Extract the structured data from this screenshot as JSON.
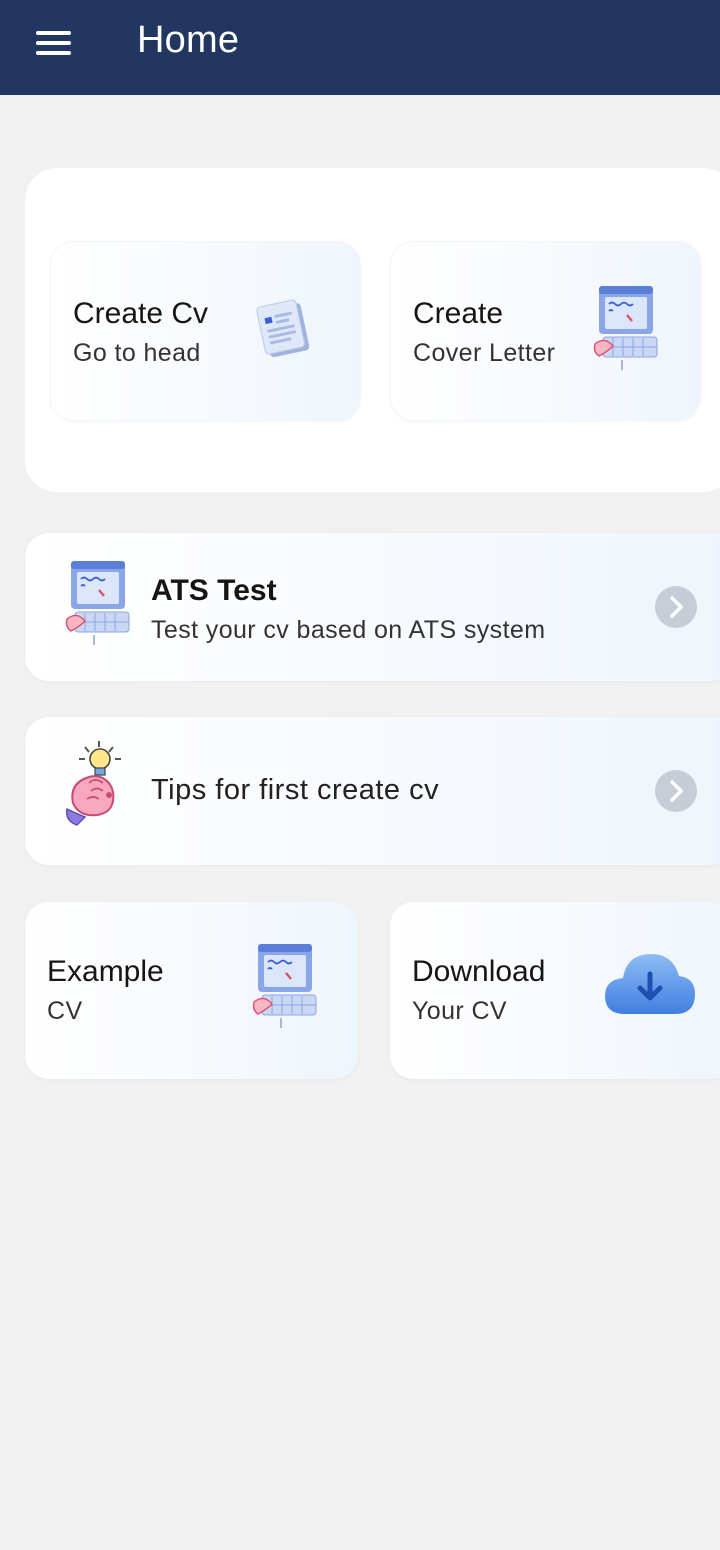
{
  "header": {
    "title": "Home",
    "menu_icon": "hamburger-menu-icon"
  },
  "top_cards": [
    {
      "title": "Create Cv",
      "subtitle": "Go to head",
      "icon": "document-icon"
    },
    {
      "title": "Create",
      "subtitle": "Cover Letter",
      "icon": "computer-icon"
    }
  ],
  "list_items": [
    {
      "title": "ATS Test",
      "subtitle": "Test your cv based on ATS system",
      "icon": "computer-icon",
      "action_icon": "chevron-right-icon"
    },
    {
      "title": "Tips for first create cv",
      "icon": "lightbulb-hand-icon",
      "action_icon": "chevron-right-icon"
    }
  ],
  "bottom_cards": [
    {
      "title": "Example",
      "subtitle": "CV",
      "icon": "computer-icon"
    },
    {
      "title": "Download",
      "subtitle": "Your CV",
      "icon": "cloud-download-icon"
    }
  ],
  "colors": {
    "appbar": "#213661",
    "background": "#f1f1f1",
    "chevron": "#c6cdd6"
  }
}
